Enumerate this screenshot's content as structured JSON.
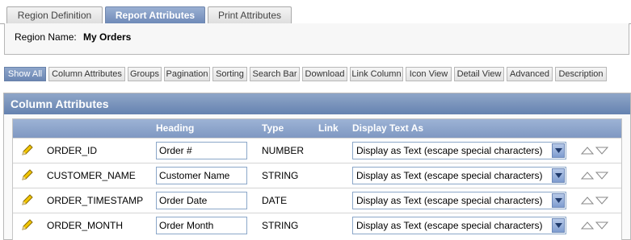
{
  "tabs": [
    "Region Definition",
    "Report Attributes",
    "Print Attributes"
  ],
  "active_tab": "Report Attributes",
  "region": {
    "label": "Region Name:",
    "value": "My Orders"
  },
  "subtabs": [
    "Show All",
    "Column Attributes",
    "Groups",
    "Pagination",
    "Sorting",
    "Search Bar",
    "Download",
    "Link Column",
    "Icon View",
    "Detail View",
    "Advanced",
    "Description"
  ],
  "active_subtab": "Show All",
  "panel": {
    "title": "Column Attributes"
  },
  "table": {
    "headers": {
      "heading": "Heading",
      "type": "Type",
      "link": "Link",
      "display": "Display Text As"
    },
    "rows": [
      {
        "column": "ORDER_ID",
        "heading": "Order #",
        "type": "NUMBER",
        "display": "Display as Text (escape special characters)"
      },
      {
        "column": "CUSTOMER_NAME",
        "heading": "Customer Name",
        "type": "STRING",
        "display": "Display as Text (escape special characters)"
      },
      {
        "column": "ORDER_TIMESTAMP",
        "heading": "Order Date",
        "type": "DATE",
        "display": "Display as Text (escape special characters)"
      },
      {
        "column": "ORDER_MONTH",
        "heading": "Order Month",
        "type": "STRING",
        "display": "Display as Text (escape special characters)"
      }
    ]
  },
  "icons": {
    "edit": "pencil-icon",
    "move_up": "triangle-up-icon",
    "move_down": "triangle-down-icon",
    "dropdown": "chevron-down-icon"
  },
  "colors": {
    "header_blue": "#7f98c2",
    "active_tab": "#6f8ab8",
    "input_border": "#8ba7c9"
  }
}
